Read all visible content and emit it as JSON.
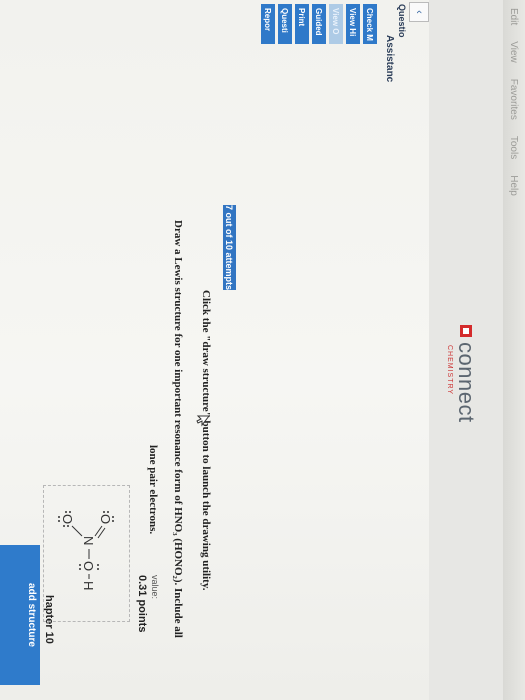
{
  "browser_menu": [
    "Edit",
    "View",
    "Favorites",
    "Tools",
    "Help"
  ],
  "brand": {
    "logo": "connect",
    "tagline": "CHEMISTRY"
  },
  "nav": {
    "prev_icon": "‹",
    "question_label": "Questio"
  },
  "chapter": "hapter 10",
  "value": {
    "label": "value:",
    "points": "0.31 points"
  },
  "question": {
    "attempts": "7 out of 10 attempts",
    "line1": "Click the \"draw structure\" button to launch the drawing utility.",
    "line2": "Draw a Lewis structure for one important resonance form of HNO₃ (HONO₂). Include all",
    "line3": "lone pair electrons."
  },
  "structure": {
    "atoms": [
      "H",
      "O",
      "N",
      "O",
      "O"
    ],
    "button_label": "add structure"
  },
  "assistance": {
    "title": "Assistanc",
    "items": [
      "Check M",
      "View Hi",
      "View O",
      "Guided",
      "Print",
      "Questi",
      "Repor"
    ]
  }
}
